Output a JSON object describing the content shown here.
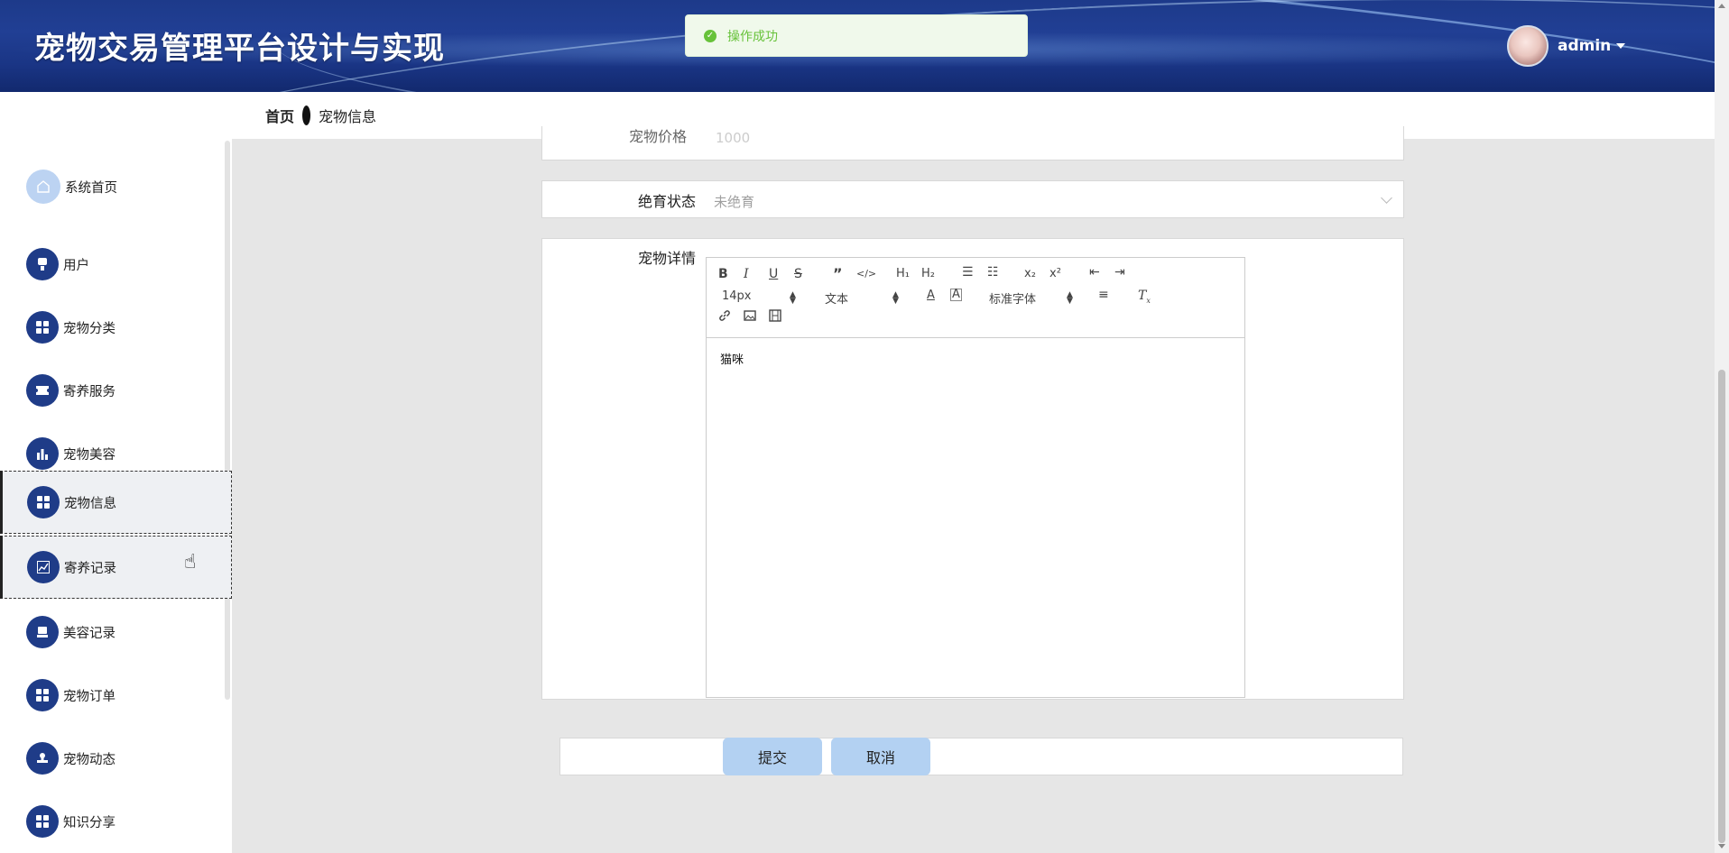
{
  "header": {
    "title": "宠物交易管理平台设计与实现",
    "username": "admin"
  },
  "toast": {
    "message": "操作成功"
  },
  "breadcrumb": {
    "home": "首页",
    "current": "宠物信息"
  },
  "sidebar": {
    "items": [
      {
        "label": "系统首页",
        "icon": "home-icon"
      },
      {
        "label": "用户",
        "icon": "user-icon"
      },
      {
        "label": "宠物分类",
        "icon": "grid-icon"
      },
      {
        "label": "寄养服务",
        "icon": "ticket-icon"
      },
      {
        "label": "宠物美容",
        "icon": "bar-chart-icon"
      },
      {
        "label": "宠物信息",
        "icon": "grid-icon",
        "active": true
      },
      {
        "label": "寄养记录",
        "icon": "trend-icon"
      },
      {
        "label": "美容记录",
        "icon": "printer-icon"
      },
      {
        "label": "宠物订单",
        "icon": "grid-icon"
      },
      {
        "label": "宠物动态",
        "icon": "stamp-icon"
      },
      {
        "label": "知识分享",
        "icon": "grid-icon"
      }
    ]
  },
  "form": {
    "price_label": "宠物价格",
    "price_value": "1000",
    "sterilization_label": "绝育状态",
    "sterilization_value": "未绝育",
    "detail_label": "宠物详情",
    "editor": {
      "font_size": "14px",
      "paragraph": "文本",
      "font_family": "标准字体",
      "content": "猫咪"
    },
    "submit_label": "提交",
    "cancel_label": "取消"
  },
  "colors": {
    "accent": "#1f3c88",
    "button": "#b3d1f2",
    "success": "#67c23a"
  }
}
